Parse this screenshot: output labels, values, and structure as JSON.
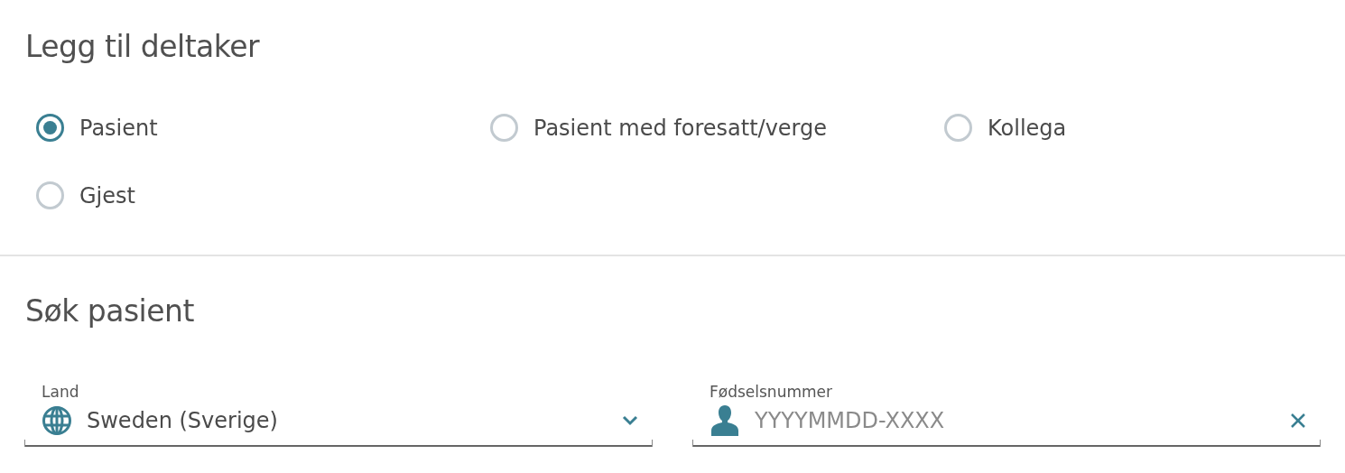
{
  "title": "Legg til deltaker",
  "participant_types": [
    {
      "label": "Pasient",
      "selected": true
    },
    {
      "label": "Pasient med foresatt/verge",
      "selected": false
    },
    {
      "label": "Kollega",
      "selected": false
    },
    {
      "label": "Gjest",
      "selected": false
    }
  ],
  "search": {
    "title": "Søk pasient",
    "fields": [
      {
        "kind": "select",
        "label": "Land",
        "value": "Sweden (Sverige)"
      },
      {
        "kind": "text",
        "label": "Fødselsnummer",
        "placeholder": "YYYYMMDD-XXXX"
      }
    ]
  }
}
